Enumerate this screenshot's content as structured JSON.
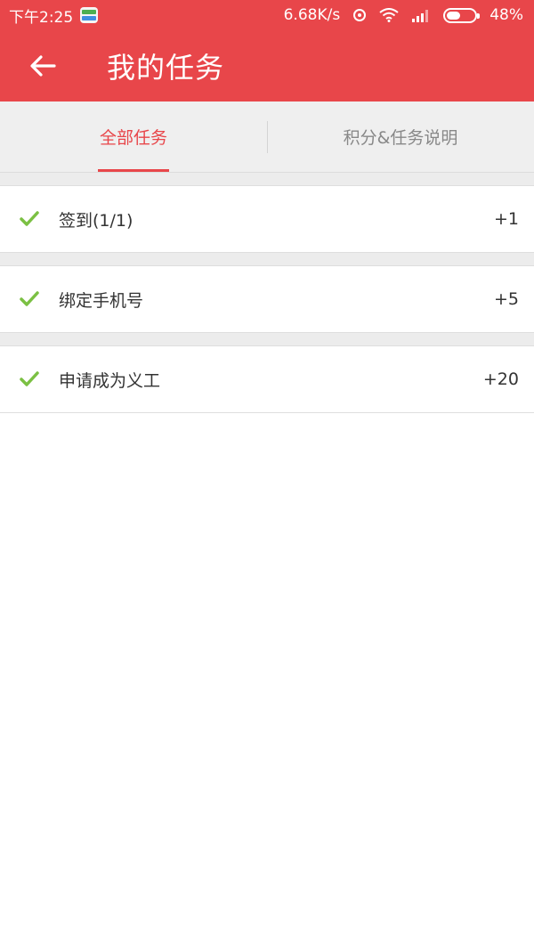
{
  "status_bar": {
    "time": "下午2:25",
    "network_speed": "6.68K/s",
    "battery_percent": "48%",
    "battery_level": 0.48
  },
  "header": {
    "title": "我的任务"
  },
  "tabs": [
    {
      "label": "全部任务",
      "active": true
    },
    {
      "label": "积分&任务说明",
      "active": false
    }
  ],
  "tasks": [
    {
      "name": "签到(1/1)",
      "points": "+1",
      "done": true
    },
    {
      "name": "绑定手机号",
      "points": "+5",
      "done": true
    },
    {
      "name": "申请成为义工",
      "points": "+20",
      "done": true
    }
  ],
  "colors": {
    "primary": "#e8464a",
    "check": "#7bc043"
  }
}
